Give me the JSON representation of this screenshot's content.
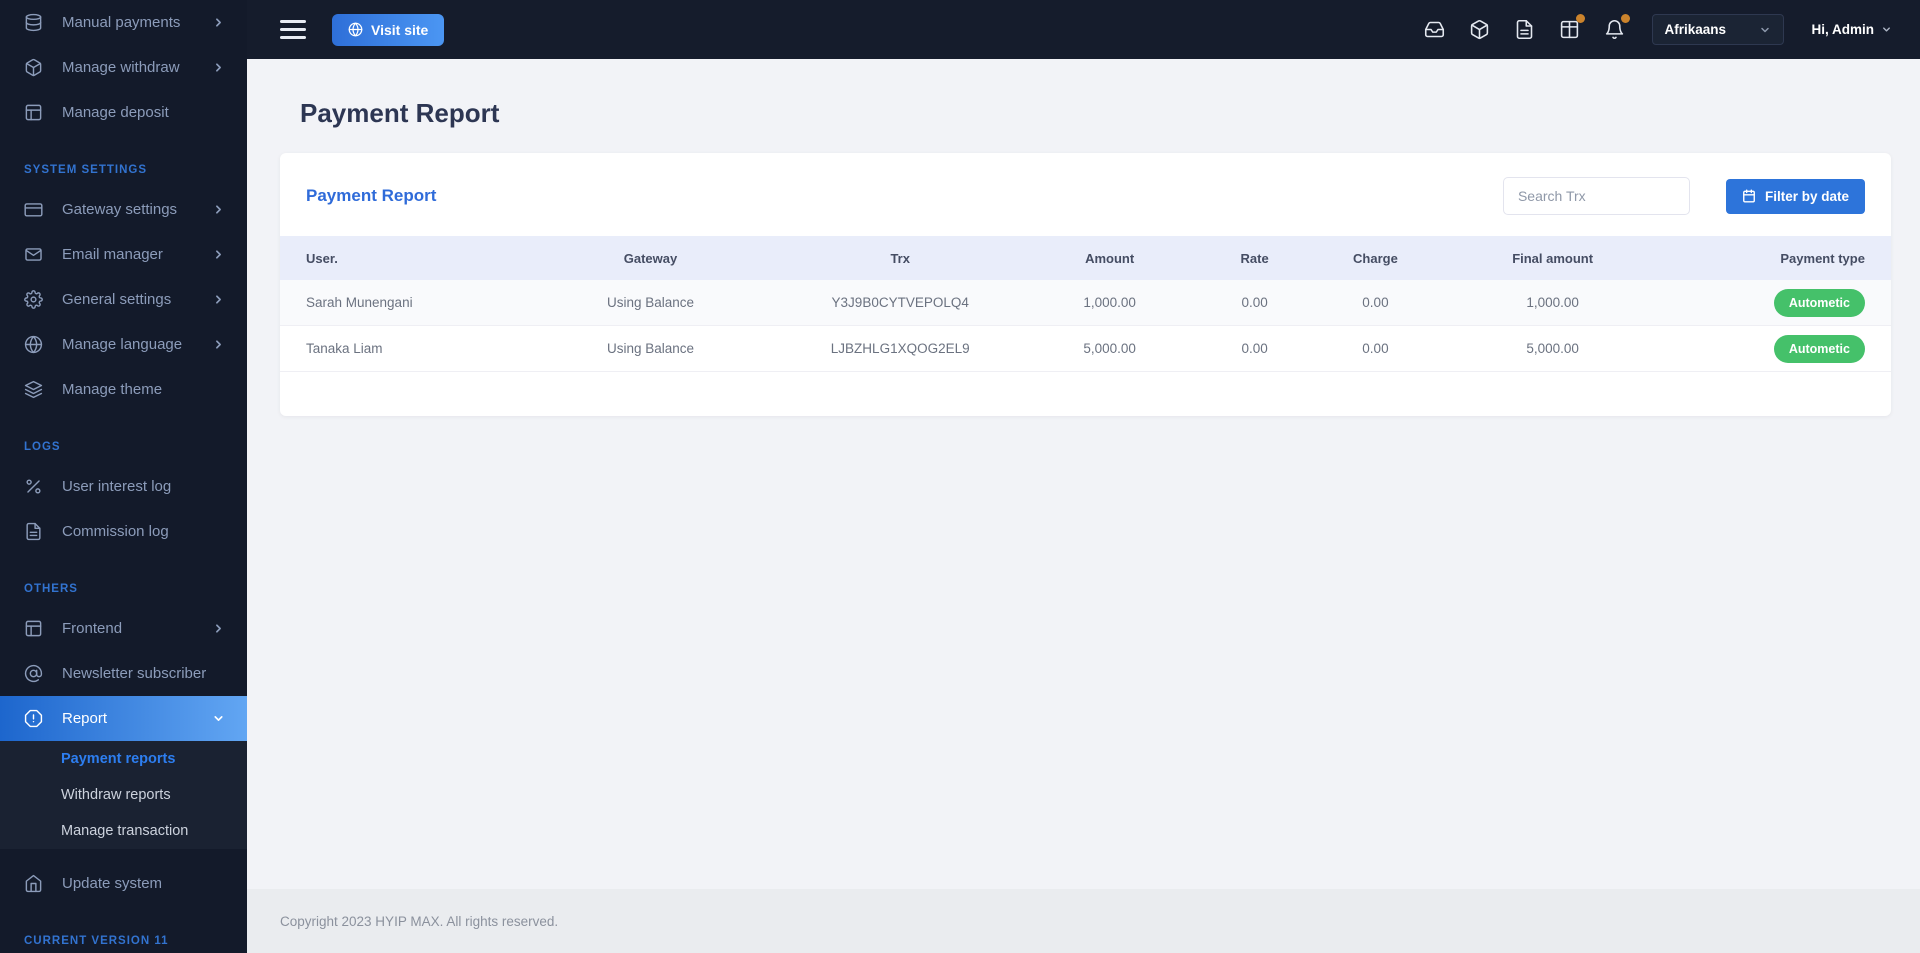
{
  "colors": {
    "sidebar_bg": "#131a2a",
    "navbar_bg": "#151c2c",
    "submenu_bg": "#1a2232",
    "section_header_blue": "#3273d0",
    "active_gradient_start": "#1d66cd",
    "active_gradient_end": "#62a6f3",
    "accent_blue": "#2d74da",
    "card_title_blue": "#2f6bd9",
    "badge_green": "#45c16a",
    "notification_dot_orange": "#cb832c",
    "table_header_bg": "#e9edfa",
    "page_bg": "#f2f3f7",
    "footer_bg": "#eaecef"
  },
  "sidebar": {
    "entries": [
      {
        "type": "item",
        "label": "Manual payments",
        "icon": "database-icon",
        "chevron": "right"
      },
      {
        "type": "item",
        "label": "Manage withdraw",
        "icon": "package-icon",
        "chevron": "right"
      },
      {
        "type": "item",
        "label": "Manage deposit",
        "icon": "layout-icon"
      },
      {
        "type": "header",
        "label": "SYSTEM SETTINGS"
      },
      {
        "type": "item",
        "label": "Gateway settings",
        "icon": "credit-card-icon",
        "chevron": "right"
      },
      {
        "type": "item",
        "label": "Email manager",
        "icon": "envelope-icon",
        "chevron": "right"
      },
      {
        "type": "item",
        "label": "General settings",
        "icon": "gear-icon",
        "chevron": "right"
      },
      {
        "type": "item",
        "label": "Manage language",
        "icon": "globe-icon",
        "chevron": "right"
      },
      {
        "type": "item",
        "label": "Manage theme",
        "icon": "layers-icon"
      },
      {
        "type": "header",
        "label": "LOGS"
      },
      {
        "type": "item",
        "label": "User interest log",
        "icon": "percent-icon"
      },
      {
        "type": "item",
        "label": "Commission log",
        "icon": "file-text-icon"
      },
      {
        "type": "header",
        "label": "OTHERS"
      },
      {
        "type": "item",
        "label": "Frontend",
        "icon": "layout-icon",
        "chevron": "right"
      },
      {
        "type": "item",
        "label": "Newsletter subscriber",
        "icon": "at-sign-icon"
      },
      {
        "type": "item",
        "label": "Report",
        "icon": "alert-octagon-icon",
        "chevron": "down",
        "active": true
      },
      {
        "type": "subitem",
        "label": "Payment reports",
        "active": true
      },
      {
        "type": "subitem",
        "label": "Withdraw reports"
      },
      {
        "type": "subitem",
        "label": "Manage transaction"
      },
      {
        "type": "gap"
      },
      {
        "type": "item",
        "label": "Update system",
        "icon": "home-icon"
      },
      {
        "type": "header",
        "label": "CURRENT VERSION 11"
      }
    ]
  },
  "navbar": {
    "visit_site": "Visit site",
    "language": "Afrikaans",
    "user": "Hi, Admin",
    "icons": [
      {
        "name": "inbox-icon",
        "badge": false
      },
      {
        "name": "package-icon",
        "badge": false
      },
      {
        "name": "file-text-icon",
        "badge": false
      },
      {
        "name": "grid-icon",
        "badge": true
      },
      {
        "name": "bell-icon",
        "badge": true
      }
    ]
  },
  "page": {
    "title": "Payment Report",
    "card_title": "Payment Report",
    "search_placeholder": "Search Trx",
    "filter_button": "Filter by date"
  },
  "table": {
    "headers": [
      "User.",
      "Gateway",
      "Trx",
      "Amount",
      "Rate",
      "Charge",
      "Final amount",
      "Payment type"
    ],
    "column_names": [
      "user",
      "gateway",
      "trx",
      "amount",
      "rate",
      "charge",
      "final-amount",
      "payment-type"
    ],
    "rows": [
      [
        "Sarah Munengani",
        "Using Balance",
        "Y3J9B0CYTVEPOLQ4",
        "1,000.00",
        "0.00",
        "0.00",
        "1,000.00",
        "Autometic"
      ],
      [
        "Tanaka Liam",
        "Using Balance",
        "LJBZHLG1XQOG2EL9",
        "5,000.00",
        "0.00",
        "0.00",
        "5,000.00",
        "Autometic"
      ]
    ]
  },
  "footer": {
    "copyright": "Copyright 2023 HYIP MAX. All rights reserved."
  }
}
